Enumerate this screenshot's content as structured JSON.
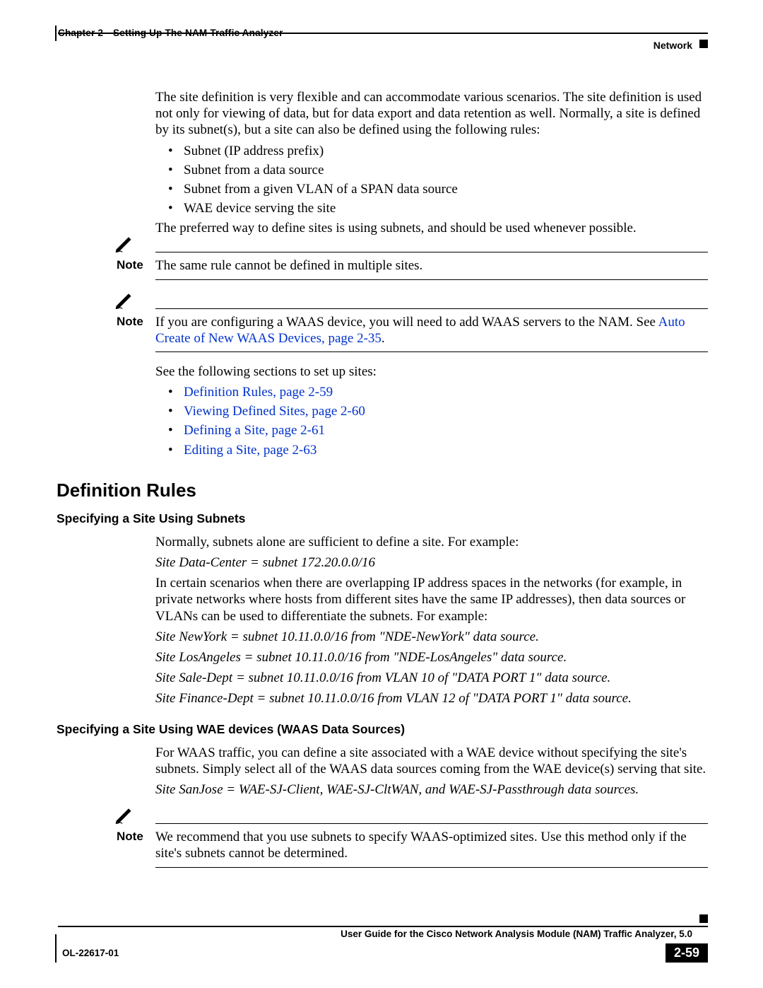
{
  "header": {
    "chapter_num": "Chapter 2",
    "chapter_title": "Setting Up The NAM Traffic Analyzer",
    "section": "Network"
  },
  "intro": {
    "p1": "The site definition is very flexible and can accommodate various scenarios. The site definition is used not only for viewing of data, but for data export and data retention as well. Normally, a site is defined by its subnet(s), but a site can also be defined using the following rules:",
    "bullets": [
      "Subnet (IP address prefix)",
      "Subnet from a data source",
      "Subnet from a given VLAN of a SPAN data source",
      "WAE device serving the site"
    ],
    "p2": "The preferred way to define sites is using subnets, and should be used whenever possible."
  },
  "note1": {
    "label": "Note",
    "text": "The same rule cannot be defined in multiple sites."
  },
  "note2": {
    "label": "Note",
    "text_pre": "If you are configuring a WAAS device, you will need to add WAAS servers to the NAM. See ",
    "link": "Auto Create of New WAAS Devices, page 2-35",
    "text_post": "."
  },
  "see_sections": {
    "intro": "See the following sections to set up sites:",
    "links": [
      "Definition Rules, page 2-59",
      "Viewing Defined Sites, page 2-60",
      "Defining a Site, page 2-61",
      "Editing a Site, page 2-63"
    ]
  },
  "h2_def_rules": "Definition Rules",
  "subnets": {
    "h3": "Specifying a Site Using Subnets",
    "p1": "Normally, subnets alone are sufficient to define a site. For example:",
    "ex1": "Site Data-Center = subnet 172.20.0.0/16",
    "p2": "In certain scenarios when there are overlapping IP address spaces in the networks (for example, in private networks where hosts from different sites have the same IP addresses), then data sources or VLANs can be used to differentiate the subnets. For example:",
    "ex2": "Site NewYork = subnet 10.11.0.0/16 from \"NDE-NewYork\" data source.",
    "ex3": "Site LosAngeles = subnet 10.11.0.0/16 from \"NDE-LosAngeles\" data source.",
    "ex4": "Site Sale-Dept = subnet 10.11.0.0/16 from VLAN 10 of \"DATA PORT 1\" data source.",
    "ex5": "Site Finance-Dept = subnet 10.11.0.0/16 from VLAN 12 of \"DATA PORT 1\" data source."
  },
  "wae": {
    "h3": "Specifying a Site Using WAE devices (WAAS Data Sources)",
    "p1": "For WAAS traffic, you can define a site associated with a WAE device without specifying the site's subnets. Simply select all of the WAAS data sources coming from the WAE device(s) serving that site.",
    "ex1": "Site SanJose = WAE-SJ-Client, WAE-SJ-CltWAN, and WAE-SJ-Passthrough data sources."
  },
  "note3": {
    "label": "Note",
    "text": "We recommend that you use subnets to specify WAAS-optimized sites. Use this method only if the site's subnets cannot be determined."
  },
  "footer": {
    "guide": "User Guide for the Cisco Network Analysis Module (NAM) Traffic Analyzer, 5.0",
    "doc": "OL-22617-01",
    "page": "2-59"
  }
}
